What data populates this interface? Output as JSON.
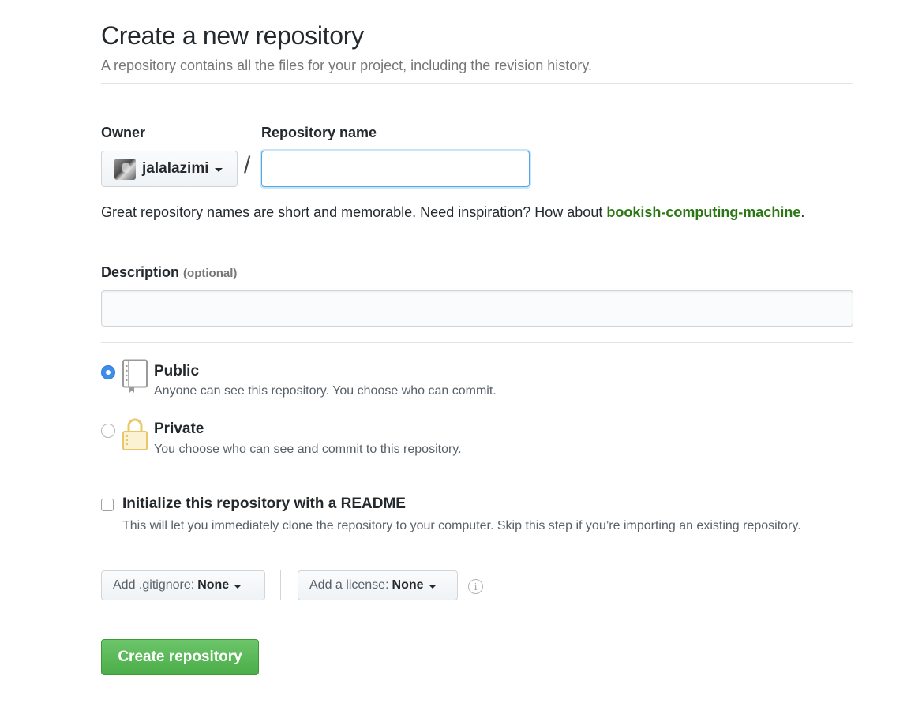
{
  "header": {
    "title": "Create a new repository",
    "subtitle": "A repository contains all the files for your project, including the revision history."
  },
  "owner": {
    "label": "Owner",
    "name": "jalalazimi"
  },
  "repository": {
    "label": "Repository name",
    "separator": "/",
    "value": ""
  },
  "hint": {
    "prefix": "Great repository names are short and memorable. Need inspiration? How about ",
    "suggestion": "bookish-computing-machine",
    "suffix": "."
  },
  "description": {
    "label": "Description",
    "note": "(optional)",
    "value": ""
  },
  "visibility": {
    "selected": "public",
    "public": {
      "title": "Public",
      "desc": "Anyone can see this repository. You choose who can commit."
    },
    "private": {
      "title": "Private",
      "desc": "You choose who can see and commit to this repository."
    }
  },
  "readme": {
    "checked": false,
    "title": "Initialize this repository with a README",
    "desc": "This will let you immediately clone the repository to your computer. Skip this step if you’re importing an existing repository."
  },
  "gitignore": {
    "label": "Add .gitignore:",
    "value": "None"
  },
  "license": {
    "label": "Add a license:",
    "value": "None"
  },
  "info_icon": "i",
  "submit": {
    "label": "Create repository"
  },
  "colors": {
    "accent_blue": "#3d8eea",
    "suggestion_green": "#2a7713",
    "button_green": "#4bad48"
  }
}
